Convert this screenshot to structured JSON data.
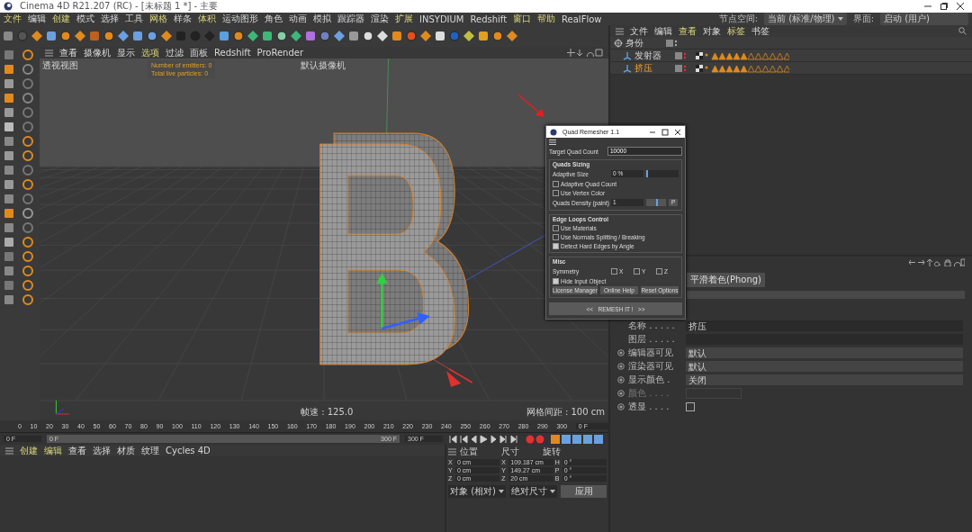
{
  "window": {
    "title": "Cinema 4D R21.207 (RC) - [未标题 1 *] - 主要"
  },
  "menu": [
    {
      "label": "文件",
      "highlighted": true
    },
    {
      "label": "编辑",
      "highlighted": false
    },
    {
      "label": "创建",
      "highlighted": true
    },
    {
      "label": "模式",
      "highlighted": false
    },
    {
      "label": "选择",
      "highlighted": false
    },
    {
      "label": "工具",
      "highlighted": false
    },
    {
      "label": "网格",
      "highlighted": true
    },
    {
      "label": "样条",
      "highlighted": false
    },
    {
      "label": "体积",
      "highlighted": true
    },
    {
      "label": "运动图形",
      "highlighted": false
    },
    {
      "label": "角色",
      "highlighted": false
    },
    {
      "label": "动画",
      "highlighted": false
    },
    {
      "label": "模拟",
      "highlighted": false
    },
    {
      "label": "跟踪器",
      "highlighted": false
    },
    {
      "label": "渲染",
      "highlighted": false
    },
    {
      "label": "扩展",
      "highlighted": true
    },
    {
      "label": "INSYDIUM",
      "highlighted": false
    },
    {
      "label": "Redshift",
      "highlighted": false
    },
    {
      "label": "窗口",
      "highlighted": true
    },
    {
      "label": "帮助",
      "highlighted": true
    },
    {
      "label": "RealFlow",
      "highlighted": false
    }
  ],
  "node_space": {
    "label": "节点空间:",
    "value": "当前 (标准/物理)"
  },
  "layout": {
    "label": "界面:",
    "value": "启动 (用户)"
  },
  "viewport": {
    "menu": [
      {
        "label": "查看",
        "highlighted": false
      },
      {
        "label": "摄像机",
        "highlighted": false
      },
      {
        "label": "显示",
        "highlighted": false
      },
      {
        "label": "选项",
        "highlighted": true
      },
      {
        "label": "过滤",
        "highlighted": false
      },
      {
        "label": "面板",
        "highlighted": false
      },
      {
        "label": "Redshift",
        "highlighted": false
      },
      {
        "label": "ProRender",
        "highlighted": false
      }
    ],
    "view_name": "透视视图",
    "camera": "默认摄像机",
    "overlay": [
      "Number of emitters: 0",
      "Total live particles: 0"
    ],
    "fps": "帧速 : 125.0",
    "grid_spacing": "网格间距 : 100 cm"
  },
  "quad_remesher": {
    "title": "Quad Remesher 1.1",
    "target": {
      "label": "Target Quad Count",
      "value": "10000"
    },
    "quads_sizing": {
      "title": "Quads Sizing",
      "adaptive_size": {
        "label": "Adaptive Size",
        "value": "0 %",
        "level": 0
      },
      "checks": [
        {
          "label": "Adaptive Quad Count",
          "checked": false
        },
        {
          "label": "Use Vertex Color",
          "checked": false
        }
      ],
      "density": {
        "label": "Quads Density (paint)",
        "value": "1",
        "level": 0.5,
        "button": "P"
      }
    },
    "edge_loops": {
      "title": "Edge Loops Control",
      "checks": [
        {
          "label": "Use Materials",
          "checked": false
        },
        {
          "label": "Use Normals Splitting / Breaking",
          "checked": false
        },
        {
          "label": "Detect Hard Edges by Angle",
          "checked": true
        }
      ]
    },
    "misc": {
      "title": "Misc",
      "symmetry_label": "Symmetry",
      "symmetry": [
        {
          "label": "X",
          "checked": false
        },
        {
          "label": "Y",
          "checked": false
        },
        {
          "label": "Z",
          "checked": false
        }
      ],
      "checks": [
        {
          "label": "Hide Input Object",
          "checked": true
        }
      ],
      "buttons": [
        "License Manager",
        "Online Help",
        "Reset Options"
      ]
    },
    "remesh_button": "<<   REMESH IT !   >>"
  },
  "object_manager": {
    "menu": [
      {
        "label": "文件",
        "highlighted": false
      },
      {
        "label": "编辑",
        "highlighted": false
      },
      {
        "label": "查看",
        "highlighted": true
      },
      {
        "label": "对象",
        "highlighted": false
      },
      {
        "label": "标签",
        "highlighted": true
      },
      {
        "label": "书签",
        "highlighted": false
      }
    ],
    "objects": [
      {
        "name": "身份",
        "selected": false,
        "children": [
          {
            "name": "发射器",
            "selected": false
          },
          {
            "name": "挤压",
            "selected": true
          }
        ]
      }
    ]
  },
  "attributes": {
    "tab_button": "平滑着色(Phong)",
    "fields": [
      {
        "kind": "text",
        "label": "名称 . . . . .",
        "value": "挤压"
      },
      {
        "kind": "text",
        "label": "图层 . . . . ."
      },
      {
        "kind": "select",
        "label": "编辑器可见",
        "value": "默认"
      },
      {
        "kind": "select",
        "label": "渲染器可见",
        "value": "默认"
      },
      {
        "kind": "select",
        "label": "显示颜色 .",
        "value": "关闭"
      },
      {
        "kind": "color",
        "label": "颜色 . . . ."
      },
      {
        "kind": "check",
        "label": "透显 . . . .",
        "checked": false
      }
    ]
  },
  "timeline": {
    "ruler": [
      "0",
      "10",
      "20",
      "30",
      "40",
      "50",
      "60",
      "70",
      "80",
      "90",
      "100",
      "110",
      "120",
      "130",
      "140",
      "150",
      "160",
      "170",
      "180",
      "190",
      "200",
      "210",
      "220",
      "230",
      "240",
      "250",
      "260",
      "270",
      "280",
      "290",
      "300"
    ],
    "current_frame": "0 F",
    "start": "0 F",
    "range_start": "0 F",
    "range_end": "300 F",
    "end": "300 F"
  },
  "material_manager": {
    "menu": [
      {
        "label": "创建",
        "highlighted": true
      },
      {
        "label": "编辑",
        "highlighted": true
      },
      {
        "label": "查看",
        "highlighted": false
      },
      {
        "label": "选择",
        "highlighted": false
      },
      {
        "label": "材质",
        "highlighted": false
      },
      {
        "label": "纹理",
        "highlighted": false
      },
      {
        "label": "Cycles 4D",
        "highlighted": false
      }
    ]
  },
  "coordinates": {
    "headers": [
      "位置",
      "尺寸",
      "旋转"
    ],
    "rows": [
      {
        "axis": "X",
        "position": "0 cm",
        "size_axis": "X",
        "size": "109.187 cm",
        "rot_axis": "H",
        "rotation": "0 °"
      },
      {
        "axis": "Y",
        "position": "0 cm",
        "size_axis": "Y",
        "size": "149.27 cm",
        "rot_axis": "P",
        "rotation": "0 °"
      },
      {
        "axis": "Z",
        "position": "0 cm",
        "size_axis": "Z",
        "size": "20 cm",
        "rot_axis": "B",
        "rotation": "0 °"
      }
    ],
    "dropdowns": [
      "对象 (相对)",
      "绝对尺寸"
    ],
    "apply": "应用"
  }
}
